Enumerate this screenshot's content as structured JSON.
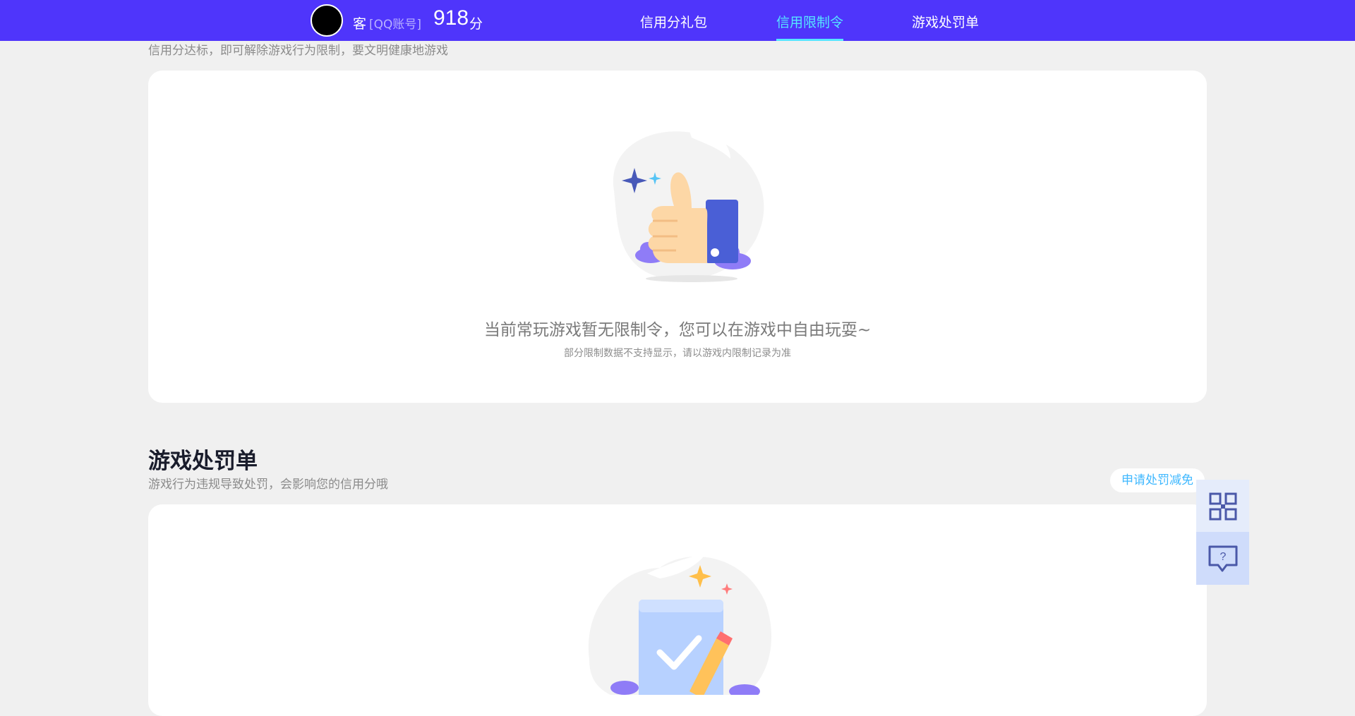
{
  "header": {
    "user_name": "客",
    "account_type": "[QQ账号]",
    "score": "918",
    "score_unit": "分",
    "tabs": [
      {
        "label": "信用分礼包",
        "active": false
      },
      {
        "label": "信用限制令",
        "active": true
      },
      {
        "label": "游戏处罚单",
        "active": false
      }
    ]
  },
  "restriction": {
    "subtitle": "信用分达标，即可解除游戏行为限制，要文明健康地游戏",
    "empty_main": "当前常玩游戏暂无限制令，您可以在游戏中自由玩耍~",
    "empty_sub": "部分限制数据不支持显示，请以游戏内限制记录为准"
  },
  "penalty": {
    "title": "游戏处罚单",
    "subtitle": "游戏行为违规导致处罚，会影响您的信用分哦",
    "apply_label": "申请处罚减免"
  },
  "side_tools": {
    "qr": "qr-code-icon",
    "help": "help-chat-icon"
  },
  "colors": {
    "header_bg": "#4f35fb",
    "active_tab": "#56e6ff",
    "page_bg": "#f0f0f0",
    "link": "#3fb8ff"
  }
}
